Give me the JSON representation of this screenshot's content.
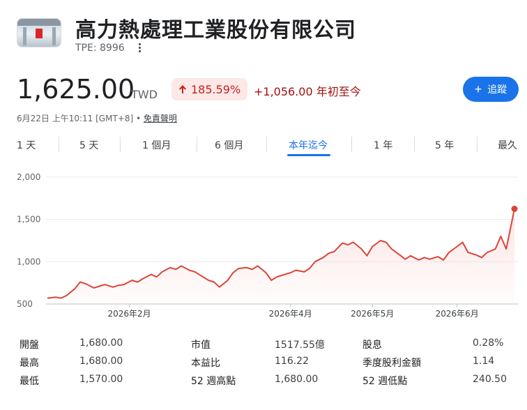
{
  "header": {
    "company_name": "高力熱處理工業股份有限公司",
    "ticker": "TPE: 8996"
  },
  "quote": {
    "price": "1,625.00",
    "currency": "TWD",
    "percent_change": "185.59%",
    "absolute_change": "+1,056.00 年初至今",
    "follow_label": "追蹤",
    "timestamp": "6月22日 上午10:11 [GMT+8] •",
    "disclaimer": "免責聲明"
  },
  "tabs": [
    {
      "label": "1 天"
    },
    {
      "label": "5 天"
    },
    {
      "label": "1 個月"
    },
    {
      "label": "6 個月"
    },
    {
      "label": "本年迄今",
      "active": true
    },
    {
      "label": "1 年"
    },
    {
      "label": "5 年"
    },
    {
      "label": "最久"
    }
  ],
  "colors": {
    "accent": "#1a73e8",
    "line": "#db4437",
    "negative_text": "#a50e0e",
    "chip_bg": "#fce8e6"
  },
  "chart_data": {
    "type": "area",
    "ylim": [
      500,
      2000
    ],
    "yticks": [
      "2,000",
      "1,500",
      "1,000",
      "500"
    ],
    "xticks": [
      {
        "label": "2026年2月",
        "x": "2026-02-01"
      },
      {
        "label": "2026年4月",
        "x": "2026-04-01"
      },
      {
        "label": "2026年5月",
        "x": "2026-05-01"
      },
      {
        "label": "2026年6月",
        "x": "2026-06-01"
      }
    ],
    "x_range": [
      "2026-01-02",
      "2026-06-22"
    ],
    "series": [
      {
        "x": [
          "2026-01-02",
          "2026-01-05",
          "2026-01-07",
          "2026-01-09",
          "2026-01-12",
          "2026-01-14",
          "2026-01-16",
          "2026-01-19",
          "2026-01-21",
          "2026-01-23",
          "2026-01-26",
          "2026-01-28",
          "2026-01-30",
          "2026-02-02",
          "2026-02-04",
          "2026-02-06",
          "2026-02-09",
          "2026-02-11",
          "2026-02-13",
          "2026-02-16",
          "2026-02-18",
          "2026-02-20",
          "2026-02-23",
          "2026-02-25",
          "2026-02-27",
          "2026-03-02",
          "2026-03-04",
          "2026-03-06",
          "2026-03-09",
          "2026-03-11",
          "2026-03-13",
          "2026-03-16",
          "2026-03-18",
          "2026-03-20",
          "2026-03-23",
          "2026-03-25",
          "2026-03-27",
          "2026-03-30",
          "2026-04-01",
          "2026-04-03",
          "2026-04-06",
          "2026-04-08",
          "2026-04-10",
          "2026-04-13",
          "2026-04-15",
          "2026-04-17",
          "2026-04-20",
          "2026-04-22",
          "2026-04-24",
          "2026-04-27",
          "2026-04-29",
          "2026-05-01",
          "2026-05-04",
          "2026-05-06",
          "2026-05-08",
          "2026-05-11",
          "2026-05-13",
          "2026-05-15",
          "2026-05-18",
          "2026-05-20",
          "2026-05-22",
          "2026-05-25",
          "2026-05-27",
          "2026-05-29",
          "2026-06-01",
          "2026-06-03",
          "2026-06-05",
          "2026-06-08",
          "2026-06-10",
          "2026-06-12",
          "2026-06-15",
          "2026-06-17",
          "2026-06-19",
          "2026-06-22"
        ],
        "values": [
          569,
          580,
          570,
          600,
          680,
          760,
          740,
          690,
          710,
          730,
          700,
          720,
          730,
          780,
          760,
          800,
          850,
          820,
          880,
          930,
          910,
          950,
          900,
          880,
          840,
          780,
          760,
          700,
          780,
          870,
          920,
          930,
          910,
          950,
          870,
          780,
          820,
          850,
          870,
          900,
          880,
          920,
          1000,
          1050,
          1100,
          1120,
          1220,
          1200,
          1230,
          1150,
          1070,
          1180,
          1250,
          1230,
          1150,
          1080,
          1030,
          1070,
          1020,
          1050,
          1030,
          1060,
          1020,
          1110,
          1180,
          1230,
          1110,
          1080,
          1050,
          1110,
          1150,
          1300,
          1150,
          1625
        ]
      }
    ]
  },
  "stats": [
    {
      "label": "開盤",
      "value": "1,680.00"
    },
    {
      "label": "最高",
      "value": "1,680.00"
    },
    {
      "label": "最低",
      "value": "1,570.00"
    },
    {
      "label": "市值",
      "value": "1517.55億"
    },
    {
      "label": "本益比",
      "value": "116.22"
    },
    {
      "label": "52 週高點",
      "value": "1,680.00"
    },
    {
      "label": "股息",
      "value": "0.28%"
    },
    {
      "label": "季度股利金額",
      "value": "1.14"
    },
    {
      "label": "52 週低點",
      "value": "240.50"
    }
  ]
}
